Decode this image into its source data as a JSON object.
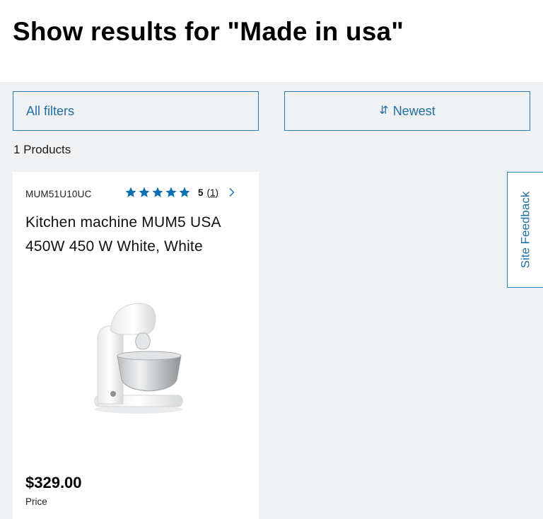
{
  "page": {
    "title": "Show results for \"Made in usa\""
  },
  "toolbar": {
    "filters_label": "All filters",
    "sort_label": "Newest"
  },
  "results": {
    "count_label": "1 Products"
  },
  "products": [
    {
      "sku": "MUM51U10UC",
      "rating": 5,
      "rating_value": "5",
      "rating_count": "(1)",
      "name": "Kitchen machine  MUM5 USA 450W  450 W  White, White",
      "price": "$329.00",
      "price_label": "Price"
    }
  ],
  "feedback": {
    "label": "Site Feedback"
  },
  "colors": {
    "accent": "#2980b9",
    "star": "#0a6fb0",
    "background": "#eff1f2"
  },
  "icons": {
    "sort": "sort-arrows-icon",
    "star": "star-icon",
    "chevron": "chevron-right-icon"
  }
}
